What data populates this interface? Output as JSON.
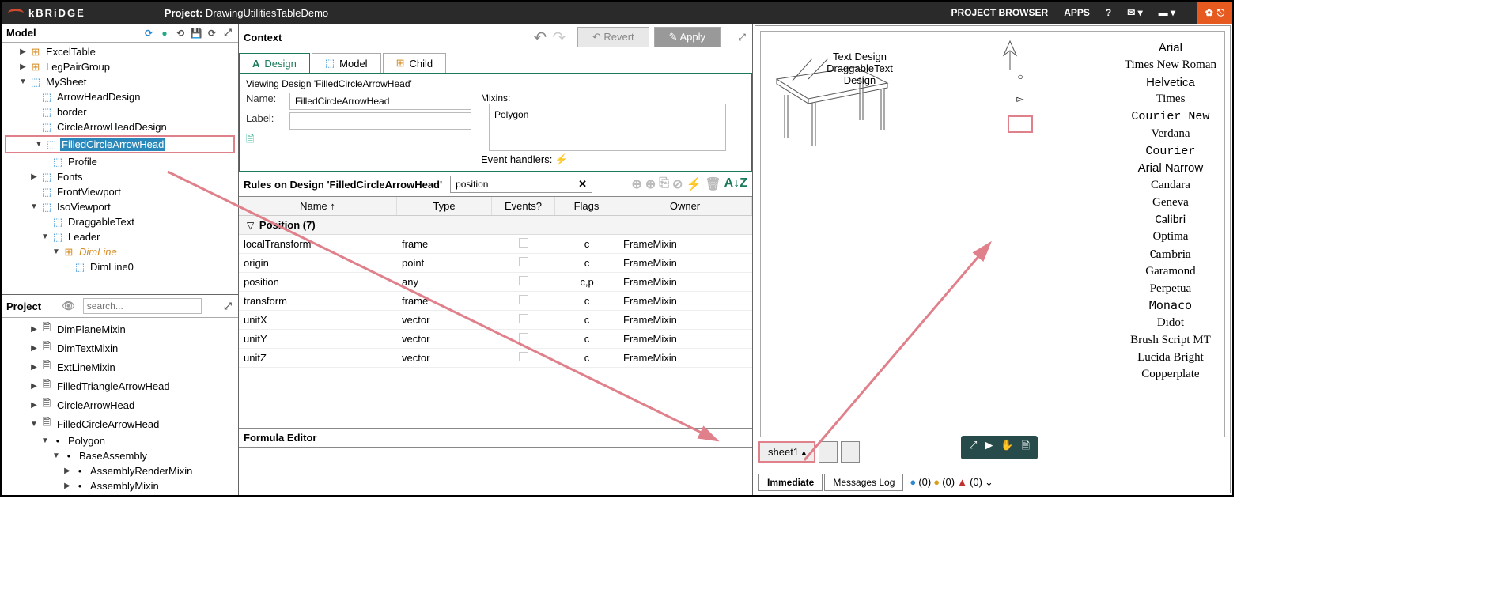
{
  "topbar": {
    "logo": "kBRiDGE",
    "project_prefix": "Project:",
    "project_name": "DrawingUtilitiesTableDemo",
    "browser": "PROJECT BROWSER",
    "apps": "APPS"
  },
  "model": {
    "title": "Model",
    "tree": [
      {
        "label": "ExcelTable",
        "ind": 1,
        "caret": "▶",
        "ico": "orange"
      },
      {
        "label": "LegPairGroup",
        "ind": 1,
        "caret": "▶",
        "ico": "orange"
      },
      {
        "label": "MySheet",
        "ind": 1,
        "caret": "▼",
        "ico": "blue"
      },
      {
        "label": "ArrowHeadDesign",
        "ind": 2,
        "caret": "",
        "ico": "blue"
      },
      {
        "label": "border",
        "ind": 2,
        "caret": "",
        "ico": "blue"
      },
      {
        "label": "CircleArrowHeadDesign",
        "ind": 2,
        "caret": "",
        "ico": "blue"
      },
      {
        "label": "FilledCircleArrowHead",
        "ind": 2,
        "caret": "▼",
        "ico": "blue",
        "sel": true,
        "hl": true
      },
      {
        "label": "Profile",
        "ind": 3,
        "caret": "",
        "ico": "blue"
      },
      {
        "label": "Fonts",
        "ind": 2,
        "caret": "▶",
        "ico": "blue"
      },
      {
        "label": "FrontViewport",
        "ind": 2,
        "caret": "",
        "ico": "blue"
      },
      {
        "label": "IsoViewport",
        "ind": 2,
        "caret": "▼",
        "ico": "blue"
      },
      {
        "label": "DraggableText",
        "ind": 3,
        "caret": "",
        "ico": "blue"
      },
      {
        "label": "Leader",
        "ind": 3,
        "caret": "▼",
        "ico": "blue"
      },
      {
        "label": "DimLine",
        "ind": 4,
        "caret": "▼",
        "ico": "orange",
        "italic": true
      },
      {
        "label": "DimLine0",
        "ind": 5,
        "caret": "",
        "ico": "blue"
      }
    ]
  },
  "project": {
    "title": "Project",
    "search_ph": "search...",
    "tree": [
      {
        "label": "DimPlaneMixin",
        "ind": 2,
        "caret": "▶",
        "ico": "doc"
      },
      {
        "label": "DimTextMixin",
        "ind": 2,
        "caret": "▶",
        "ico": "doc"
      },
      {
        "label": "ExtLineMixin",
        "ind": 2,
        "caret": "▶",
        "ico": "doc"
      },
      {
        "label": "FilledTriangleArrowHead",
        "ind": 2,
        "caret": "▶",
        "ico": "doc"
      },
      {
        "label": "CircleArrowHead",
        "ind": 2,
        "caret": "▶",
        "ico": "doc"
      },
      {
        "label": "FilledCircleArrowHead",
        "ind": 2,
        "caret": "▼",
        "ico": "doc"
      },
      {
        "label": "Polygon",
        "ind": 3,
        "caret": "▼",
        "ico": "dot"
      },
      {
        "label": "BaseAssembly",
        "ind": 4,
        "caret": "▼",
        "ico": "dot"
      },
      {
        "label": "AssemblyRenderMixin",
        "ind": 5,
        "caret": "▶",
        "ico": "dot"
      },
      {
        "label": "AssemblyMixin",
        "ind": 5,
        "caret": "▶",
        "ico": "dot"
      }
    ]
  },
  "context": {
    "title": "Context",
    "revert": "Revert",
    "apply": "Apply",
    "tabs": {
      "design": "Design",
      "model": "Model",
      "child": "Child"
    },
    "viewing": "Viewing Design 'FilledCircleArrowHead'",
    "name_lbl": "Name:",
    "name_val": "FilledCircleArrowHead",
    "label_lbl": "Label:",
    "mixins_lbl": "Mixins:",
    "mixins_val": "Polygon",
    "evh": "Event handlers:"
  },
  "rules": {
    "title_prefix": "Rules on Design ",
    "title_name": "'FilledCircleArrowHead'",
    "search": "position",
    "cols": {
      "name": "Name",
      "type": "Type",
      "ev": "Events?",
      "flags": "Flags",
      "owner": "Owner"
    },
    "group": "Position (7)",
    "rows": [
      {
        "name": "localTransform",
        "type": "frame",
        "flags": "c",
        "owner": "FrameMixin"
      },
      {
        "name": "origin",
        "type": "point",
        "flags": "c",
        "owner": "FrameMixin"
      },
      {
        "name": "position",
        "type": "any",
        "flags": "c,p",
        "owner": "FrameMixin"
      },
      {
        "name": "transform",
        "type": "frame",
        "flags": "c",
        "owner": "FrameMixin"
      },
      {
        "name": "unitX",
        "type": "vector",
        "flags": "c",
        "owner": "FrameMixin"
      },
      {
        "name": "unitY",
        "type": "vector",
        "flags": "c",
        "owner": "FrameMixin"
      },
      {
        "name": "unitZ",
        "type": "vector",
        "flags": "c",
        "owner": "FrameMixin"
      }
    ],
    "formula": "Formula Editor"
  },
  "viewport": {
    "text1": "Text Design",
    "text2": "DraggableText Design",
    "fonts": [
      "Arial",
      "Times New Roman",
      "Helvetica",
      "Times",
      "Courier New",
      "Verdana",
      "Courier",
      "Arial Narrow",
      "Candara",
      "Geneva",
      "Calibri",
      "Optima",
      "Cambria",
      "Garamond",
      "Perpetua",
      "Monaco",
      "Didot",
      "Brush Script MT",
      "Lucida Bright",
      "Copperplate"
    ],
    "sheet": "sheet1",
    "immediate": "Immediate",
    "msglog": "Messages Log",
    "status": "(0)"
  }
}
